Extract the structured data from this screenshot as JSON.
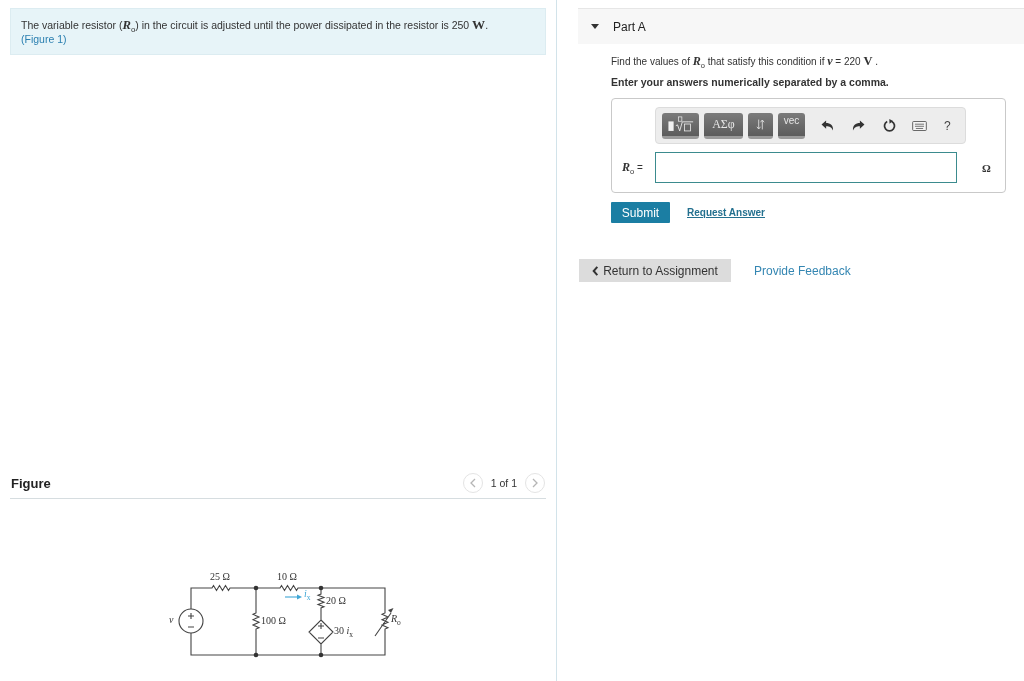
{
  "problem": {
    "text": "The variable resistor (*R*$_{o}$) in the circuit is adjusted until the power dissipated in the resistor is 250 **W**.",
    "link": "(Figure 1)"
  },
  "figure": {
    "title": "Figure",
    "pager": "1 of 1",
    "circuit": {
      "source": "*v*",
      "resistors": [
        "25 Ω",
        "10 Ω",
        "20 Ω",
        "100 Ω"
      ],
      "current": "*i*$_{x}$",
      "dependent_source": "30 *i*$_{x}$",
      "variable_resistor": "*R*$_{o}$"
    }
  },
  "part": {
    "title": "Part A",
    "expanded": true,
    "prompt": "Find the values of *R*$_{o}$ that satisfy this condition if *v* = 220 **V** .",
    "instruction": "Enter your answers numerically separated by a comma.",
    "toolbar": {
      "symbols": "ΑΣφ",
      "vector": "vec",
      "help": "?"
    },
    "answer": {
      "label": "*R*$_{o}$ =",
      "unit": "Ω"
    },
    "submit": "Submit",
    "request": "Request Answer"
  },
  "footer": {
    "back": "Return to Assignment",
    "feedback": "Provide Feedback"
  }
}
